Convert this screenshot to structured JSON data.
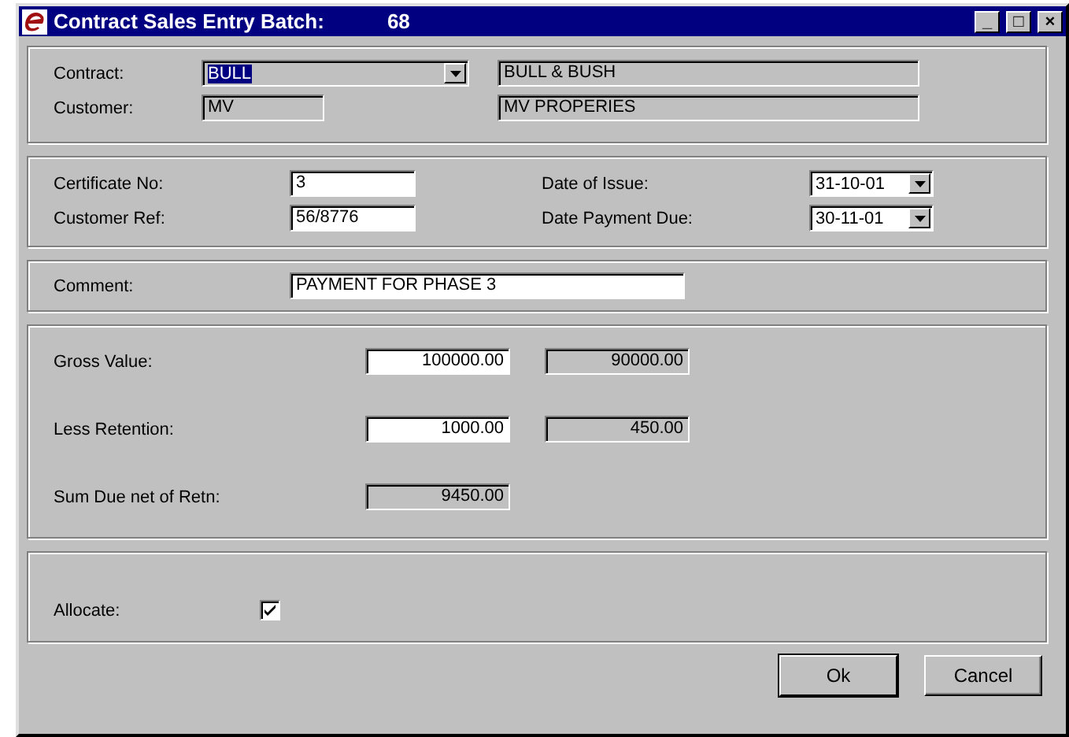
{
  "window": {
    "title": "Contract Sales Entry Batch:",
    "batch_number": "68",
    "controls": [
      "_",
      "□",
      "×"
    ]
  },
  "contract": {
    "label": "Contract:",
    "value": "BULL",
    "name": "BULL & BUSH"
  },
  "customer": {
    "label": "Customer:",
    "value": "MV",
    "name": "MV PROPERIES"
  },
  "certificate_no": {
    "label": "Certificate No:",
    "value": "3"
  },
  "customer_ref": {
    "label": "Customer Ref:",
    "value": "56/8776"
  },
  "date_of_issue": {
    "label": "Date of Issue:",
    "value": "31-10-01"
  },
  "date_payment_due": {
    "label": "Date Payment Due:",
    "value": "30-11-01"
  },
  "comment": {
    "label": "Comment:",
    "value": "PAYMENT FOR PHASE 3"
  },
  "values": [
    {
      "label": "Gross Value:",
      "input": "100000.00",
      "computed": "90000.00"
    },
    {
      "label": "Less Retention:",
      "input": "1000.00",
      "computed": "450.00"
    },
    {
      "label": "Sum Due net of Retn:",
      "computed": "9450.00"
    }
  ],
  "allocate": {
    "label": "Allocate:",
    "checked": true
  },
  "buttons": [
    "Ok",
    "Cancel"
  ]
}
